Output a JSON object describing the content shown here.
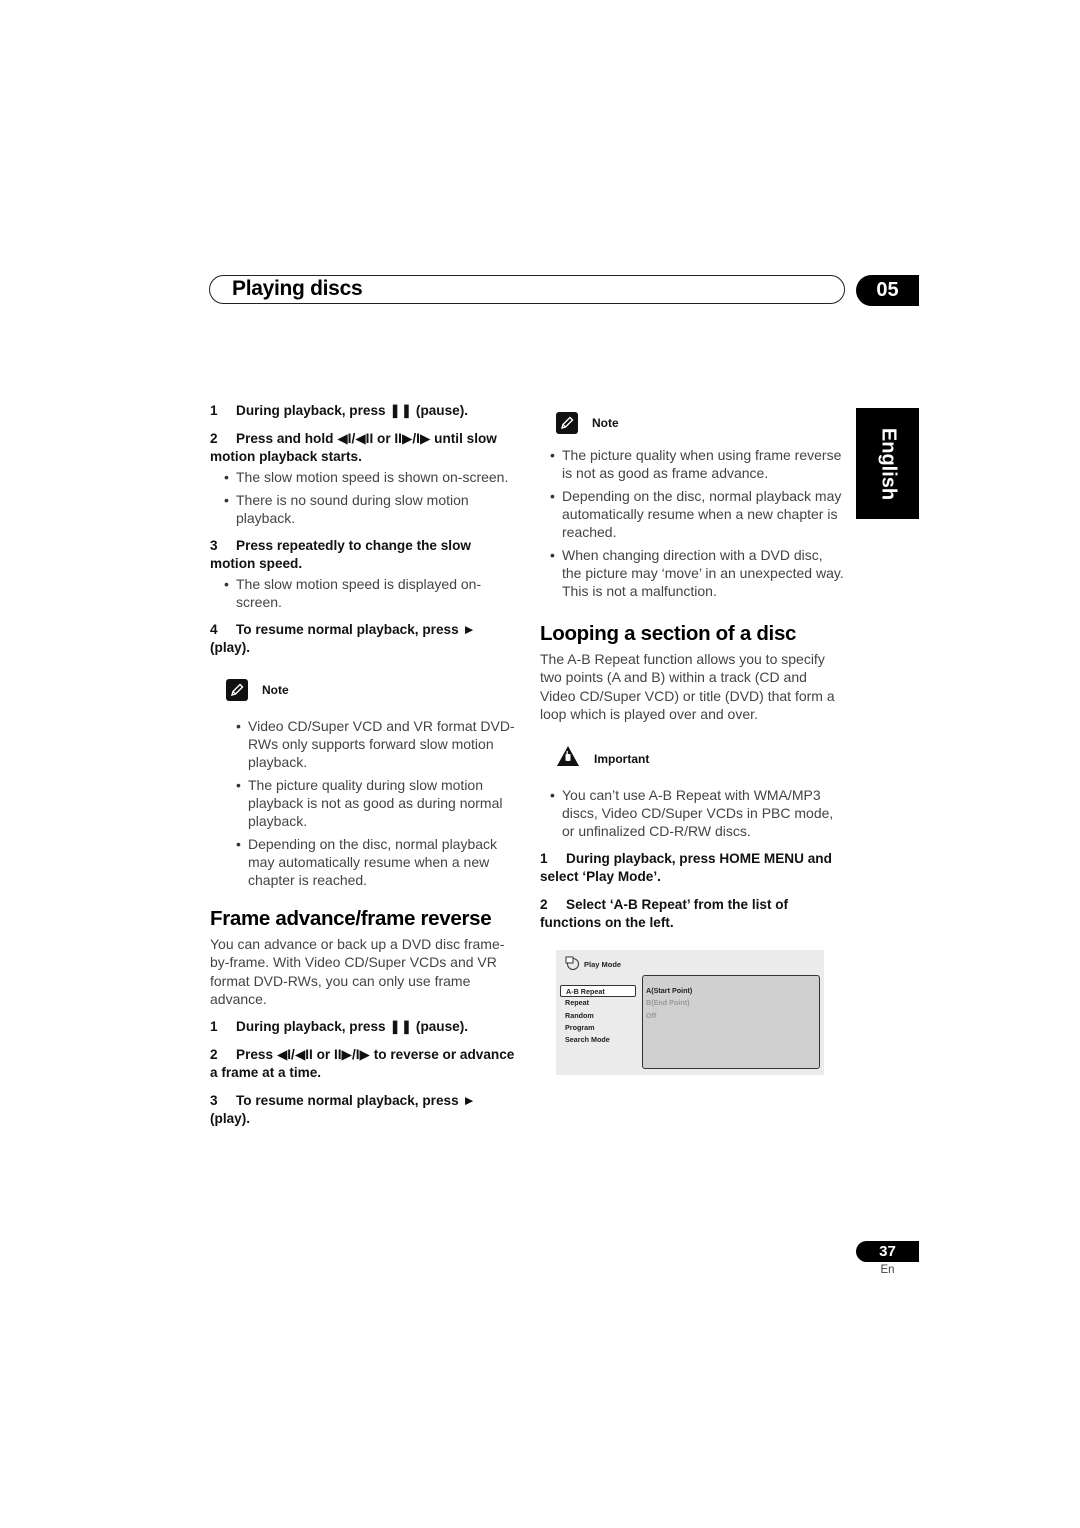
{
  "header": {
    "title": "Playing discs",
    "chapter": "05"
  },
  "language_tab": "English",
  "left_column": {
    "slow_motion_steps": [
      {
        "num": "1",
        "text": "During playback, press ❚❚ (pause)."
      },
      {
        "num": "2",
        "text": "Press and hold ◀I/◀II or II▶/I▶ until slow motion playback starts."
      }
    ],
    "step2_bullets": [
      "The slow motion speed is shown on-screen.",
      "There is no sound during slow motion playback."
    ],
    "step3": {
      "num": "3",
      "text": "Press repeatedly to change the slow motion speed."
    },
    "step3_bullets": [
      "The slow motion speed is displayed on-screen."
    ],
    "step4": {
      "num": "4",
      "text": "To resume normal playback, press ► (play)."
    },
    "note": {
      "label": "Note",
      "icon": "pencil-icon",
      "bullets": [
        "Video CD/Super VCD and VR format DVD-RWs only supports forward slow motion playback.",
        "The picture quality during slow motion playback is not as good as during normal playback.",
        "Depending on the disc, normal playback may automatically resume when a new chapter is reached."
      ]
    },
    "frame_section": {
      "heading": "Frame advance/frame reverse",
      "intro": "You can advance or back up a DVD disc frame-by-frame. With Video CD/Super VCDs and VR format DVD-RWs, you can only use frame advance.",
      "steps": [
        {
          "num": "1",
          "text": "During playback, press ❚❚ (pause)."
        },
        {
          "num": "2",
          "text": "Press ◀I/◀II or II▶/I▶ to reverse or advance a frame at a time."
        },
        {
          "num": "3",
          "text": "To resume normal playback, press ► (play)."
        }
      ]
    }
  },
  "right_column": {
    "note": {
      "label": "Note",
      "icon": "pencil-icon",
      "bullets": [
        "The picture quality when using frame reverse is not as good as frame advance.",
        "Depending on the disc, normal playback may automatically resume when a new chapter is reached.",
        "When changing direction with a DVD disc, the picture may ‘move’ in an unexpected way. This is not a malfunction."
      ]
    },
    "loop_section": {
      "heading": "Looping a section of a disc",
      "intro": "The A-B Repeat function allows you to specify two points (A and B) within a track (CD and Video CD/Super VCD) or title (DVD) that form a loop which is played over and over.",
      "important": {
        "label": "Important",
        "icon": "warning-hand-icon",
        "bullets": [
          "You can’t use A-B Repeat with WMA/MP3 discs, Video CD/Super VCDs in PBC mode, or unfinalized CD-R/RW discs."
        ]
      },
      "steps": [
        {
          "num": "1",
          "text": "During playback, press HOME MENU and select ‘Play Mode’."
        },
        {
          "num": "2",
          "text": "Select ‘A-B Repeat’ from the list of functions on the left."
        }
      ]
    },
    "screen": {
      "title": "Play Mode",
      "menu": [
        "A-B Repeat",
        "Repeat",
        "Random",
        "Program",
        "Search Mode"
      ],
      "selected_menu": "A-B Repeat",
      "options": [
        {
          "label": "A(Start Point)",
          "state": "active"
        },
        {
          "label": "B(End Point)",
          "state": "dim"
        },
        {
          "label": "Off",
          "state": "dim"
        }
      ]
    }
  },
  "footer": {
    "page_number": "37",
    "language_code": "En"
  }
}
